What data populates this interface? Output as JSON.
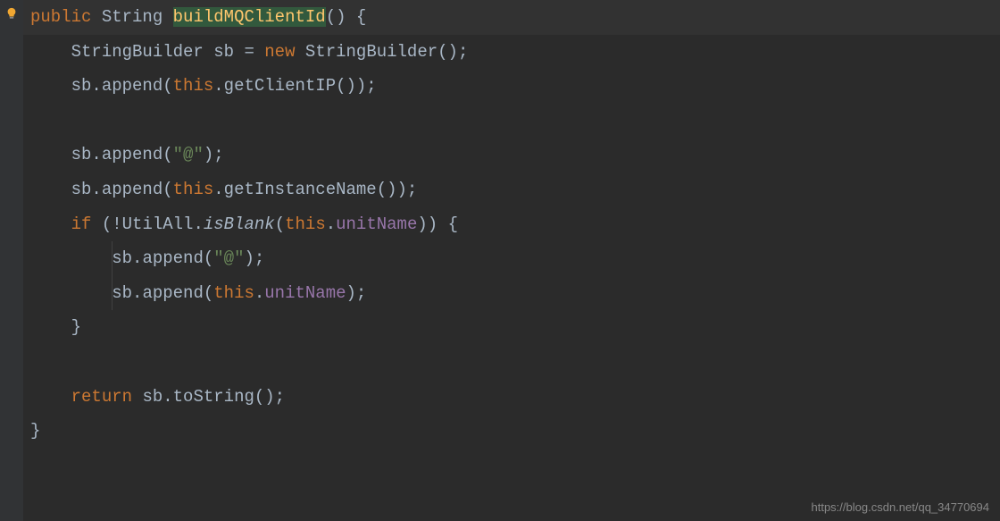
{
  "gutter": {
    "bulb_icon": "lightbulb-icon"
  },
  "code": {
    "line1": {
      "kw1": "public",
      "sp1": " ",
      "type": "String",
      "sp2": " ",
      "method": "buildMQClientId",
      "paren": "()",
      "sp3": " ",
      "brace": "{"
    },
    "line2": {
      "indent": "    ",
      "type1": "StringBuilder",
      "sp1": " ",
      "var": "sb",
      "sp2": " ",
      "eq": "=",
      "sp3": " ",
      "kw": "new",
      "sp4": " ",
      "type2": "StringBuilder",
      "tail": "();"
    },
    "line3": {
      "indent": "    ",
      "var": "sb",
      "dot1": ".",
      "call1": "append",
      "op": "(",
      "kw": "this",
      "dot2": ".",
      "call2": "getClientIP",
      "tail": "());"
    },
    "line4": {
      "blank": ""
    },
    "line5": {
      "indent": "    ",
      "var": "sb",
      "dot": ".",
      "call": "append",
      "op": "(",
      "str": "\"@\"",
      "cp": ")",
      "semi": ";"
    },
    "line6": {
      "indent": "    ",
      "var": "sb",
      "dot1": ".",
      "call1": "append",
      "op": "(",
      "kw": "this",
      "dot2": ".",
      "call2": "getInstanceName",
      "tail": "());"
    },
    "line7": {
      "indent": "    ",
      "kw1": "if",
      "sp1": " ",
      "op": "(",
      "neg": "!",
      "cls": "UtilAll",
      "dot1": ".",
      "static": "isBlank",
      "op2": "(",
      "kw2": "this",
      "dot2": ".",
      "field": "unitName",
      "cp": "))",
      "sp2": " ",
      "brace": "{"
    },
    "line8": {
      "indent": "        ",
      "var": "sb",
      "dot": ".",
      "call": "append",
      "op": "(",
      "str": "\"@\"",
      "cp": ")",
      "semi": ";"
    },
    "line9": {
      "indent": "        ",
      "var": "sb",
      "dot1": ".",
      "call": "append",
      "op": "(",
      "kw": "this",
      "dot2": ".",
      "field": "unitName",
      "cp": ")",
      "semi": ";"
    },
    "line10": {
      "indent": "    ",
      "brace": "}"
    },
    "line11": {
      "blank": ""
    },
    "line12": {
      "indent": "    ",
      "kw": "return",
      "sp": " ",
      "var": "sb",
      "dot": ".",
      "call": "toString",
      "tail": "();"
    },
    "line13": {
      "brace": "}"
    }
  },
  "watermark": "https://blog.csdn.net/qq_34770694"
}
